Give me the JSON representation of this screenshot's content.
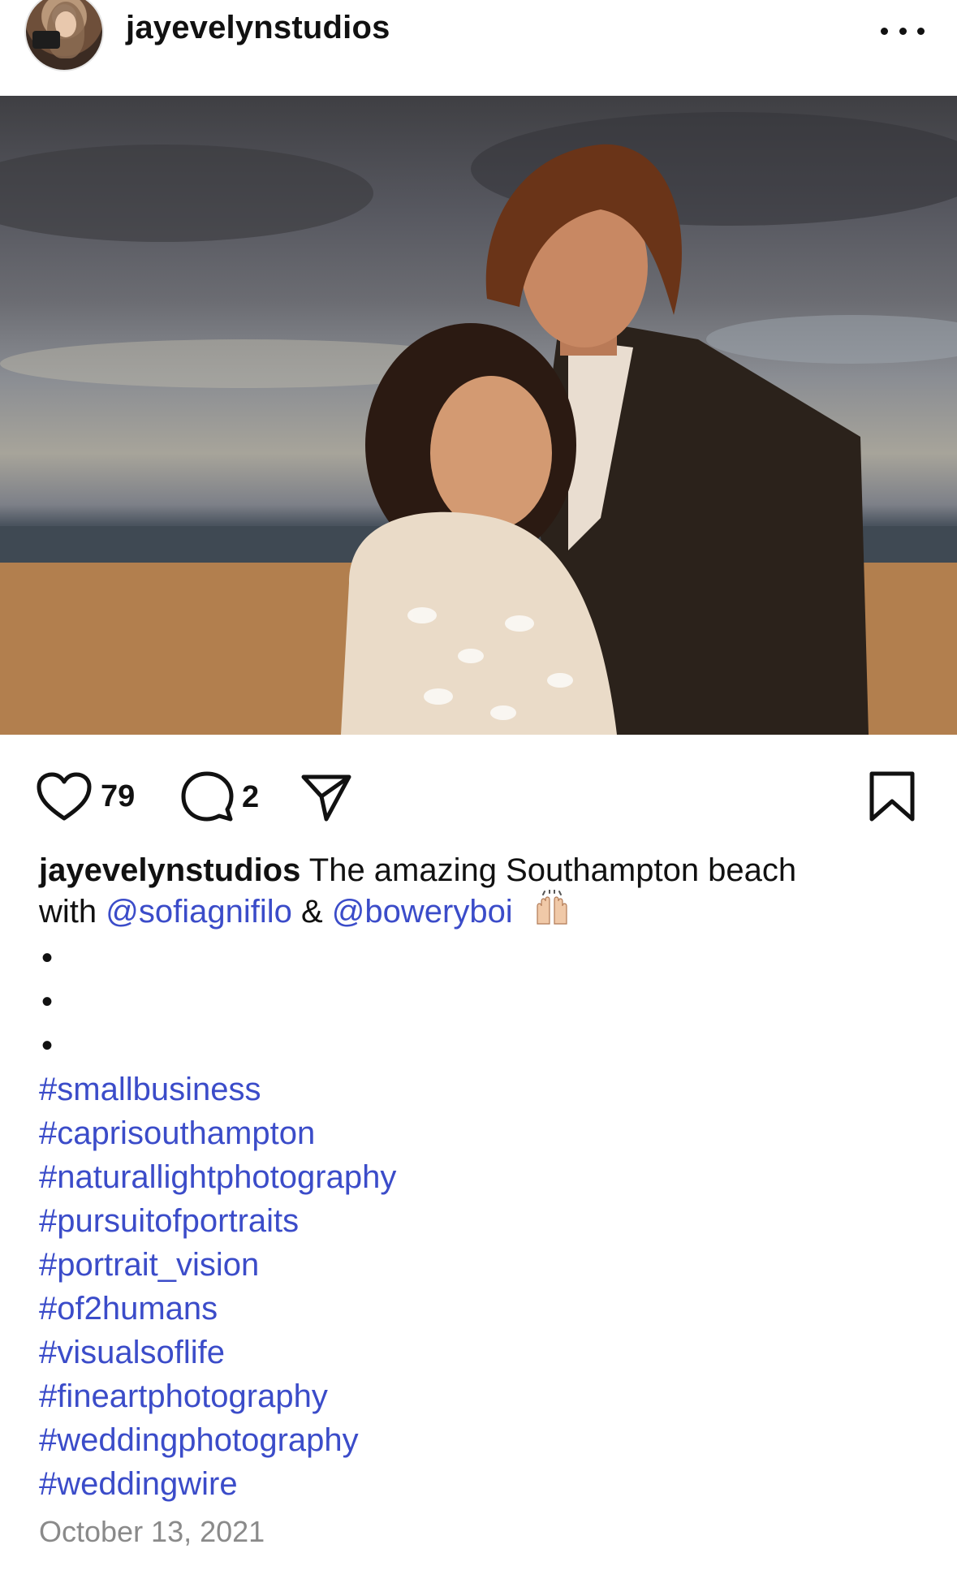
{
  "post": {
    "username": "jayevelynstudios",
    "likes": "79",
    "comments": "2",
    "caption_user": "jayevelynstudios",
    "caption_text_1": " The amazing Southampton beach",
    "caption_text_2": "with ",
    "mention_1": "@sofiagnifilo",
    "amp": " & ",
    "mention_2": "@boweryboi",
    "dots": [
      "•",
      "•",
      "•"
    ],
    "hashtags": [
      "#smallbusiness",
      "#caprisouthampton",
      "#naturallightphotography",
      "#pursuitofportraits",
      "#portrait_vision",
      "#of2humans",
      "#visualsoflife",
      "#fineartphotography",
      "#weddingphotography",
      "#weddingwire"
    ],
    "date": "October 13, 2021"
  },
  "colors": {
    "link": "#3b4cc9",
    "date": "#8a8a8a"
  },
  "icons": [
    "more-icon",
    "heart-icon",
    "comment-icon",
    "share-icon",
    "bookmark-icon"
  ]
}
